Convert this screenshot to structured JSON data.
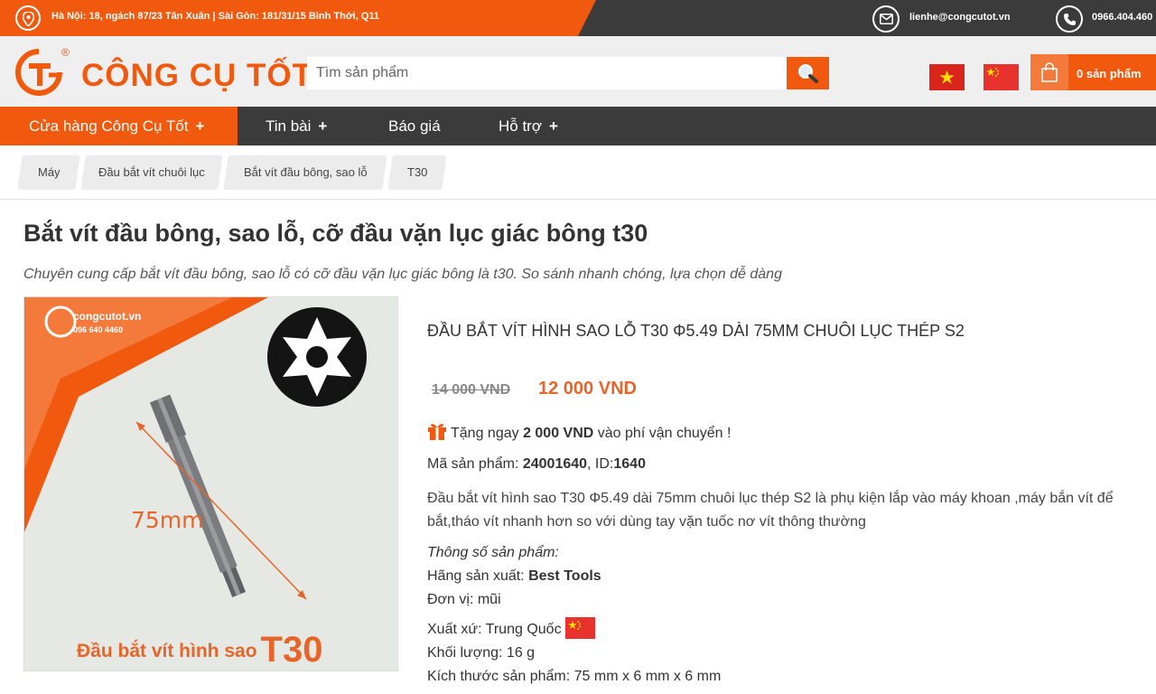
{
  "topbar": {
    "address": "Hà Nội: 18, ngách 87/23 Tân Xuân | Sài Gòn: 181/31/15 Bình Thới, Q11",
    "email": "lienhe@congcutot.vn",
    "phone": "0966.404.460"
  },
  "header": {
    "logo_text": "CÔNG CỤ TỐT",
    "logo_reg": "®",
    "search_placeholder": "Tìm sản phẩm",
    "cart_label": "0 sản phẩm"
  },
  "nav": [
    {
      "label": "Cửa hàng Công Cụ Tốt",
      "plus": "+"
    },
    {
      "label": "Tin bài",
      "plus": "+"
    },
    {
      "label": "Báo giá",
      "plus": ""
    },
    {
      "label": "Hỗ trợ",
      "plus": "+"
    }
  ],
  "breadcrumb": [
    "Máy",
    "Đầu bắt vít chuôi lục",
    "Bắt vít đầu bông, sao lỗ",
    "T30"
  ],
  "page": {
    "title": "Bắt vít đầu bông, sao lỗ, cỡ đầu vặn lục giác bông t30",
    "subtitle": "Chuyên cung cấp bắt vít đầu bông, sao lỗ có cỡ đầu vặn lục giác bông là t30. So sánh nhanh chóng, lựa chọn dễ dàng"
  },
  "image": {
    "brand": "congcutot.vn",
    "phone": "096 640 4460",
    "dimension": "75mm",
    "caption": "Đầu bắt vít hình sao",
    "caption_big": "T30"
  },
  "product": {
    "name": "ĐẦU BẮT VÍT HÌNH SAO LỖ T30 Φ5.49 DÀI 75MM CHUÔI LỤC THÉP S2",
    "price_old": "14 000 VND",
    "price_new": "12 000 VND",
    "gift_prefix": "Tặng ngay",
    "gift_amount": "2 000 VND",
    "gift_suffix": "vào phí vận chuyển !",
    "sku_label": "Mã sản phẩm:",
    "sku": "24001640",
    "id_label": ", ID:",
    "id": "1640",
    "description": "Đầu bắt vít hình sao T30 Φ5.49 dài 75mm chuôi lục thép S2 là phụ kiện lắp vào máy khoan ,máy bắn vít để bắt,tháo vít nhanh hơn so với dùng tay vặn tuốc nơ vít thông thường",
    "specs_title": "Thông số sản phẩm:",
    "maker_label": "Hãng sản xuất:",
    "maker": "Best Tools",
    "unit_label": "Đơn vị:",
    "unit": "mũi",
    "origin_label": "Xuất xứ:",
    "origin": "Trung Quốc",
    "weight_label": "Khối lượng:",
    "weight": "16 g",
    "size_label": "Kích thước sản phẩm:",
    "size": "75 mm x 6 mm x 6 mm"
  },
  "colors": {
    "brand_orange": "#f0590e",
    "dark_bar": "#3b3b3b",
    "price_orange": "#e8652a"
  }
}
